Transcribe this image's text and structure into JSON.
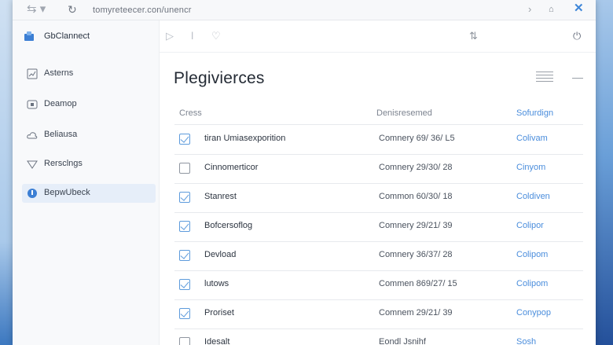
{
  "browser": {
    "url": "tomyreteecer.con/unencr"
  },
  "sidebar": {
    "brand": "GbClannect",
    "items": [
      {
        "label": "Asterns",
        "icon": "chart-icon",
        "active": false
      },
      {
        "label": "Deamop",
        "icon": "window-icon",
        "active": false
      },
      {
        "label": "Beliausa",
        "icon": "cloud-icon",
        "active": false
      },
      {
        "label": "Rersclngs",
        "icon": "shield-icon",
        "active": false
      },
      {
        "label": "BepwUbeck",
        "icon": "info-icon",
        "active": true
      }
    ]
  },
  "page": {
    "title": "Plegivierces"
  },
  "table": {
    "headers": {
      "name": "Cress",
      "date": "Denisresemed",
      "action": "Sofurdign"
    },
    "rows": [
      {
        "name": "tiran Umiasexporition",
        "date": "Comnery 69/ 36/ L5",
        "action": "Colivam",
        "checked": true
      },
      {
        "name": "Cinnomerticor",
        "date": "Comnery 29/30/ 28",
        "action": "Cinyom",
        "checked": false
      },
      {
        "name": "Stanrest",
        "date": "Common 60/30/ 18",
        "action": "Coldiven",
        "checked": true
      },
      {
        "name": "Bofcersoflog",
        "date": "Comnery 29/21/ 39",
        "action": "Colipor",
        "checked": true
      },
      {
        "name": "Devload",
        "date": "Comnery 36/37/ 28",
        "action": "Colipom",
        "checked": true
      },
      {
        "name": "lutows",
        "date": "Commen 869/27/ 15",
        "action": "Colipom",
        "checked": true
      },
      {
        "name": "Proriset",
        "date": "Comnem 29/21/ 39",
        "action": "Conypop",
        "checked": true
      },
      {
        "name": "Idesalt",
        "date": "Eondl Jsnihf",
        "action": "Sosh",
        "checked": false
      }
    ]
  }
}
